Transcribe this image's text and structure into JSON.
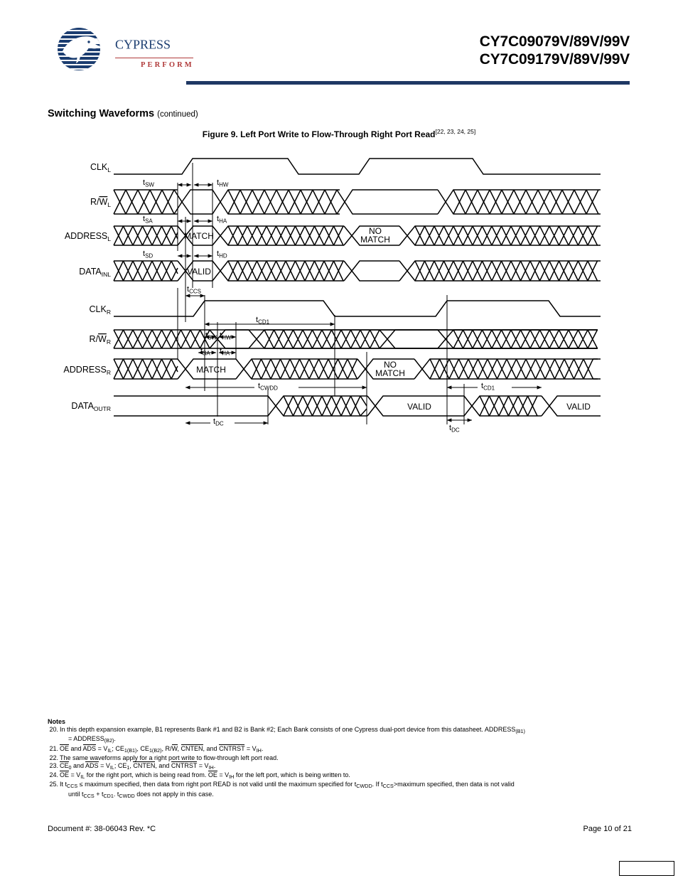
{
  "header": {
    "logo_word": "CYPRESS",
    "logo_tagline": "PERFORM",
    "part_line1": "CY7C09079V/89V/99V",
    "part_line2": "CY7C09179V/89V/99V",
    "rule_color": "#1f3864"
  },
  "section": {
    "title": "Switching Waveforms",
    "continued": "(continued)"
  },
  "figure": {
    "caption": "Figure 9.  Left Port Write to Flow-Through Right Port Read",
    "footnote_refs": "[22, 23, 24, 25]"
  },
  "waveform": {
    "signals": [
      {
        "name": "CLK",
        "sub": "L",
        "type": "clock"
      },
      {
        "name": "R/W̅",
        "sub": "L",
        "type": "bus"
      },
      {
        "name": "ADDRESS",
        "sub": "L",
        "type": "bus",
        "boxes": [
          "MATCH",
          "NO MATCH"
        ]
      },
      {
        "name": "DATA",
        "sub": "INL",
        "type": "bus",
        "boxes": [
          "VALID"
        ]
      },
      {
        "name": "CLK",
        "sub": "R",
        "type": "clock"
      },
      {
        "name": "R/W̅",
        "sub": "R",
        "type": "bus"
      },
      {
        "name": "ADDRESS",
        "sub": "R",
        "type": "bus",
        "boxes": [
          "MATCH",
          "NO MATCH"
        ]
      },
      {
        "name": "DATA",
        "sub": "OUTR",
        "type": "bus",
        "boxes": [
          "VALID",
          "VALID"
        ]
      }
    ],
    "timing_labels": [
      {
        "name": "t",
        "sub": "SW"
      },
      {
        "name": "t",
        "sub": "HW"
      },
      {
        "name": "t",
        "sub": "SA"
      },
      {
        "name": "t",
        "sub": "HA"
      },
      {
        "name": "t",
        "sub": "SD"
      },
      {
        "name": "t",
        "sub": "HD"
      },
      {
        "name": "t",
        "sub": "CCS"
      },
      {
        "name": "t",
        "sub": "CD1"
      },
      {
        "name": "t",
        "sub": "CWDD"
      },
      {
        "name": "t",
        "sub": "DC"
      }
    ],
    "box_labels": {
      "match": "MATCH",
      "no_match_l1": "NO",
      "no_match_l2": "MATCH",
      "valid": "VALID"
    }
  },
  "notes": {
    "title": "Notes",
    "items": [
      {
        "num": "20.",
        "line1": "In this depth expansion example, B1 represents Bank #1 and B2 is Bank #2; Each Bank consists of one Cypress dual-port device from this datasheet. ADDRESS",
        "line1_sub": "(B1)",
        "line2_pre": "= ADDRESS",
        "line2_sub": "(B2)",
        "line2_post": "."
      },
      {
        "num": "21.",
        "text": "OE and ADS = V IL ; CE 1(B1) , CE 1(B2) , R/W, CNTEN, and CNTRST = V IH ."
      },
      {
        "num": "22.",
        "text": "The same waveforms apply for a right port write to flow-through left port read."
      },
      {
        "num": "23.",
        "text": "CE 0 and ADS = V IL ; CE 1 , CNTEN, and CNTRST = V IH ."
      },
      {
        "num": "24.",
        "text": "OE = V IL for the right port, which is being read from. OE = V IH for the left port, which is being written to."
      },
      {
        "num": "25.",
        "line1": "It t CCS ≤ maximum specified, then data from right port READ is not valid until the maximum specified for t CWDD . If t CCS >maximum specified, then data is not valid",
        "line2": "until t CCS + t CD1 . t CWDD does not apply in this case."
      }
    ]
  },
  "footer": {
    "document": "Document #: 38-06043 Rev. *C",
    "page": "Page 10 of 21"
  }
}
